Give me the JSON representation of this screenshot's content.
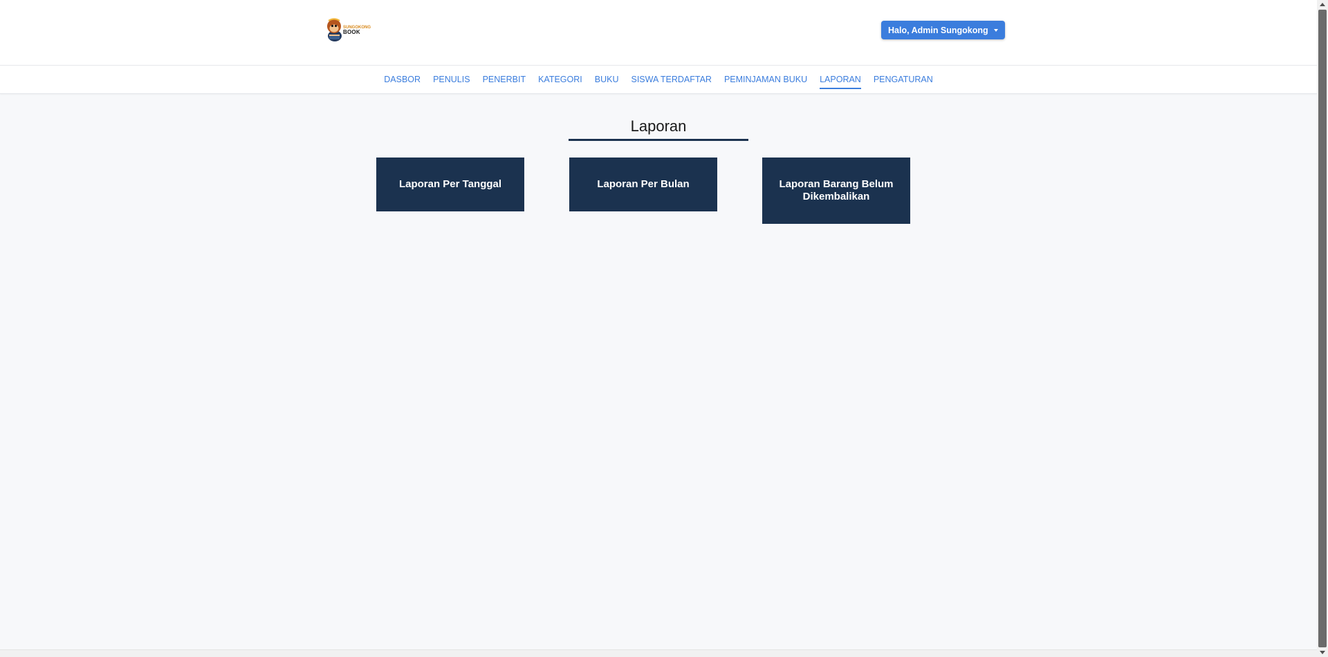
{
  "header": {
    "logo_text_top": "SUNGOKONG",
    "logo_text_bottom": "BOOK",
    "user_menu_label": "Halo, Admin Sungokong"
  },
  "nav": {
    "items": [
      {
        "label": "DASBOR"
      },
      {
        "label": "PENULIS"
      },
      {
        "label": "PENERBIT"
      },
      {
        "label": "KATEGORI"
      },
      {
        "label": "BUKU"
      },
      {
        "label": "SISWA TERDAFTAR"
      },
      {
        "label": "PEMINJAMAN BUKU"
      },
      {
        "label": "LAPORAN"
      },
      {
        "label": "PENGATURAN"
      }
    ],
    "active": "LAPORAN"
  },
  "main": {
    "title": "Laporan",
    "cards": [
      {
        "label": "Laporan Per Tanggal"
      },
      {
        "label": "Laporan Per Bulan"
      },
      {
        "label": "Laporan Barang Belum Dikembalikan"
      }
    ]
  },
  "colors": {
    "primary": "#3b7ddd",
    "card": "#1b324f",
    "background": "#f7f8fa"
  }
}
